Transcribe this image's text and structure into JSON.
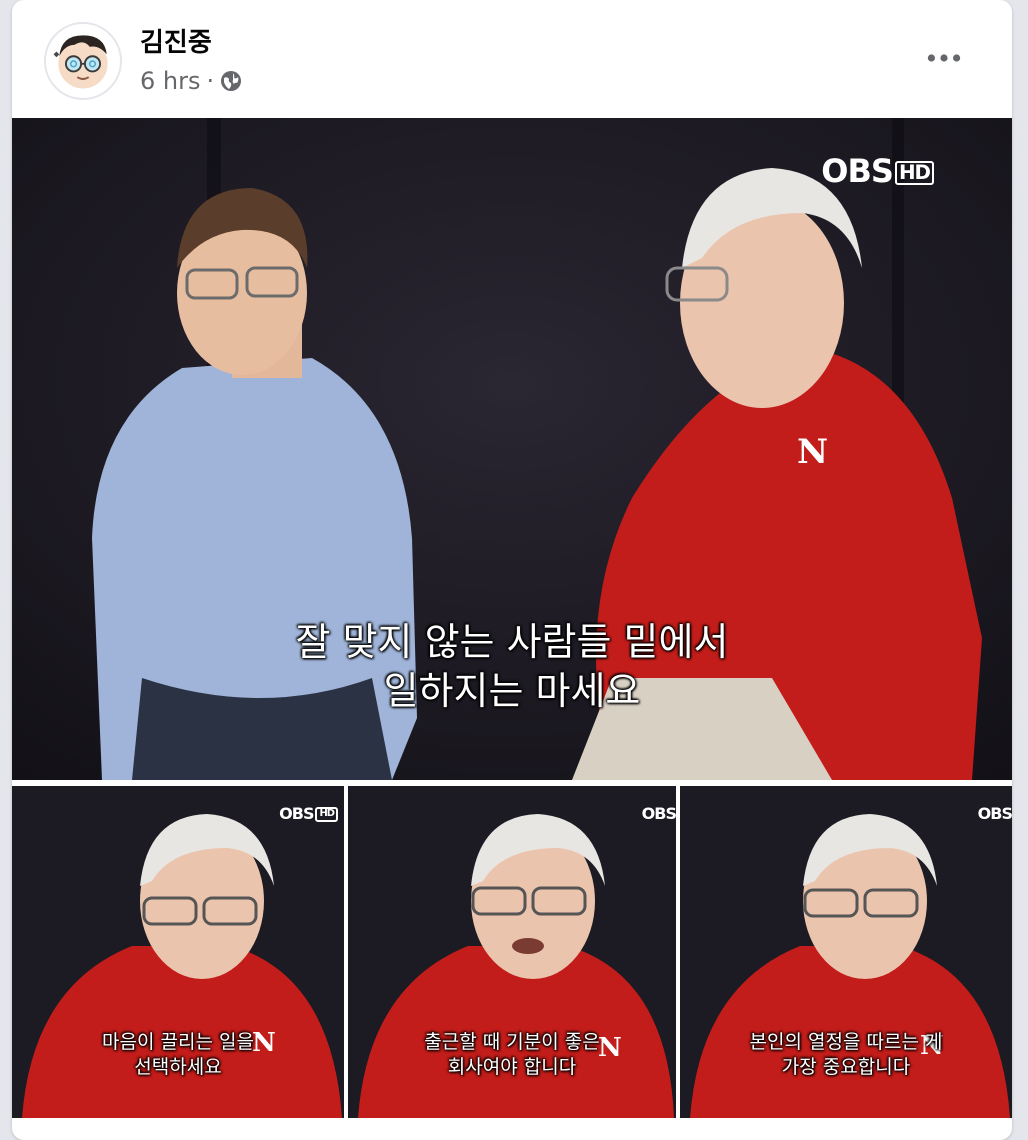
{
  "post": {
    "author": "김진중",
    "time": "6 hrs",
    "separator": "·",
    "privacy_icon": "globe-icon",
    "more_icon": "more-horizontal-icon"
  },
  "photos": {
    "main": {
      "logo": "OBS",
      "logo_hd": "HD",
      "subtitle_line1": "잘 맞지 않는 사람들 밑에서",
      "subtitle_line2": "일하지는 마세요"
    },
    "thumb1": {
      "logo": "OBS",
      "logo_hd": "HD",
      "subtitle_line1": "마음이 끌리는 일을",
      "subtitle_line2": "선택하세요"
    },
    "thumb2": {
      "logo": "OBS",
      "subtitle_line1": "출근할 때 기분이 좋은",
      "subtitle_line2": "회사여야 합니다"
    },
    "thumb3": {
      "logo": "OBS",
      "subtitle_line1": "본인의 열정을 따르는 게",
      "subtitle_line2": "가장 중요합니다"
    }
  },
  "colors": {
    "card": "#ffffff",
    "page_bg": "#e4e6eb",
    "author": "#050505",
    "meta": "#65676b",
    "photo_bg": "#1a1820",
    "red_shirt": "#c21d1a",
    "blue_shirt": "#9fb4d8"
  }
}
